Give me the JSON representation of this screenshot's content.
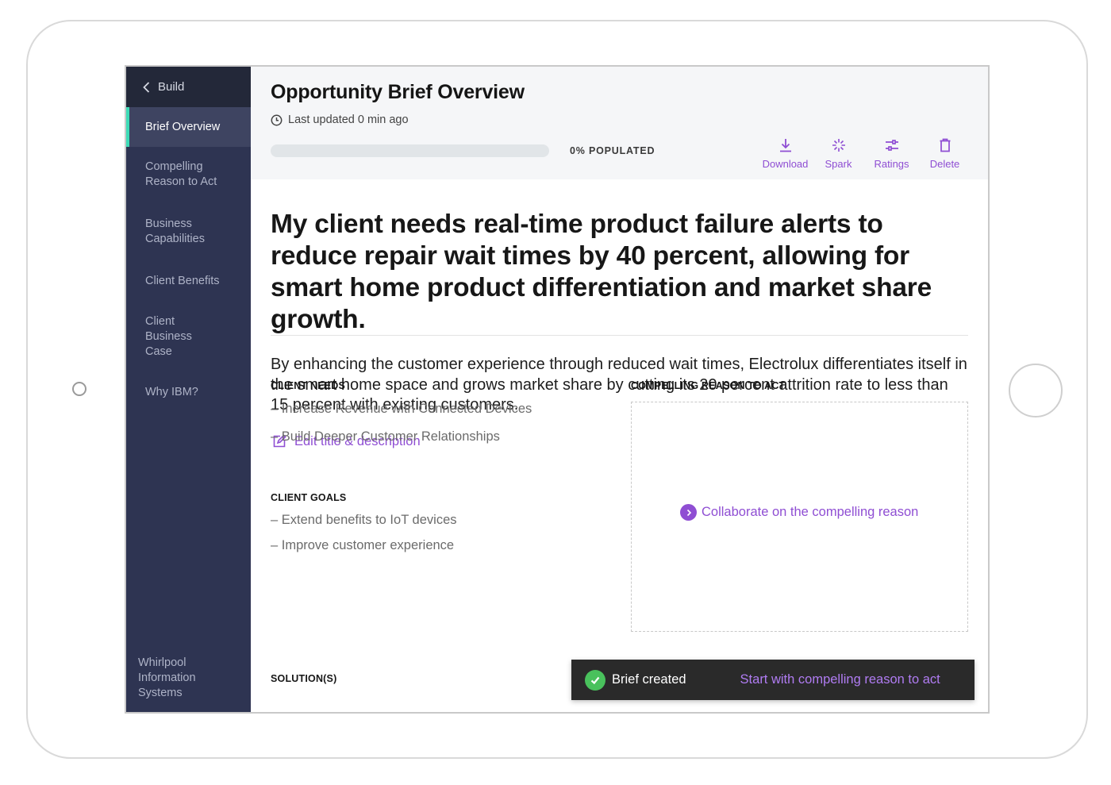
{
  "sidebar": {
    "back_label": "Build",
    "items": [
      {
        "label": "Brief Overview",
        "active": true
      },
      {
        "label": "Compelling Reason to Act"
      },
      {
        "label": "Business Capabilities"
      },
      {
        "label": "Client Benefits"
      },
      {
        "label": "Client Business Case"
      },
      {
        "label": "Why IBM?"
      }
    ],
    "footer": "Whirlpool Information Systems"
  },
  "header": {
    "title": "Opportunity Brief Overview",
    "last_updated": "Last updated 0 min ago",
    "progress_fraction": 0,
    "populated_label": "0% POPULATED",
    "actions": {
      "download": {
        "label": "Download",
        "icon": "download-icon"
      },
      "spark": {
        "label": "Spark",
        "icon": "spark-icon"
      },
      "ratings": {
        "label": "Ratings",
        "icon": "sliders-icon"
      },
      "delete": {
        "label": "Delete",
        "icon": "trash-icon"
      }
    }
  },
  "brief": {
    "headline": "My client needs real-time product failure alerts to reduce repair wait times by 40 percent, allowing for smart home product differentiation and market share growth.",
    "description": "By enhancing the customer experience through reduced wait times, Electrolux differentiates itself in the smart home space and grows market share by cutting its 20 percent attrition rate to less than 15 percent with existing customers.",
    "edit_label": "Edit title & description"
  },
  "client_needs": {
    "label": "CLIENT NEEDS",
    "items": [
      "– Increase Revenue with Connected Devices",
      "– Build Deeper Customer Relationships"
    ]
  },
  "client_goals": {
    "label": "CLIENT GOALS",
    "items": [
      "– Extend benefits to IoT devices",
      "– Improve customer experience"
    ]
  },
  "solutions": {
    "label": "SOLUTION(S)"
  },
  "compelling_reason": {
    "label": "COMPELLING REASON TO ACT",
    "collaborate_label": "Collaborate on the compelling reason"
  },
  "toast": {
    "message": "Brief created",
    "action": "Start with compelling reason to act"
  },
  "colors": {
    "accent": "#8f4ed3",
    "sidebar_bg": "#2e3452",
    "active_indicator": "#3ddbb6",
    "success": "#49c15c"
  }
}
